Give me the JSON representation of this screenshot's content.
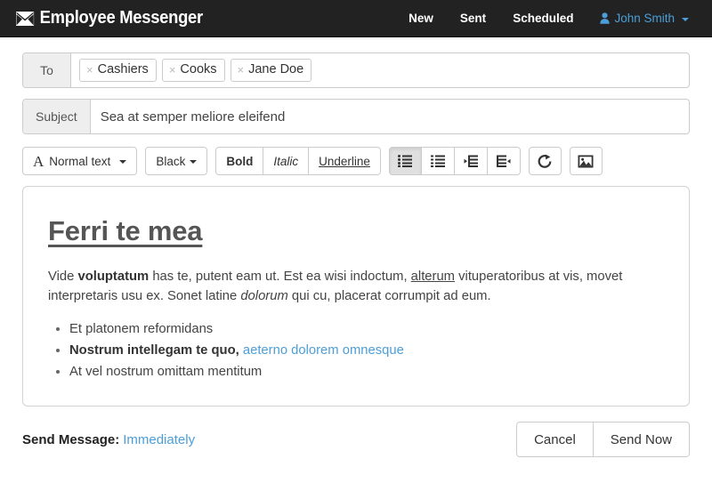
{
  "navbar": {
    "brand": "Employee Messenger",
    "brand_icon": "envelope-icon",
    "links": [
      {
        "label": "New"
      },
      {
        "label": "Sent"
      },
      {
        "label": "Scheduled"
      }
    ],
    "user": {
      "name": "John Smith",
      "icon": "user-icon",
      "caret": "chevron-down-icon"
    },
    "background_color": "#222222",
    "link_color": "#ffffff",
    "user_color": "#4c9ed9"
  },
  "compose": {
    "to": {
      "label": "To",
      "tags": [
        {
          "remove": "×",
          "label": "Cashiers"
        },
        {
          "remove": "×",
          "label": "Cooks"
        },
        {
          "remove": "×",
          "label": "Jane Doe"
        }
      ]
    },
    "subject": {
      "label": "Subject",
      "value": "Sea at semper meliore eleifend",
      "placeholder": "Subject"
    }
  },
  "toolbar": {
    "text_style": {
      "glyph": "A",
      "label": "Normal text",
      "icon": "chevron-down-icon"
    },
    "text_color": {
      "label": "Black",
      "icon": "chevron-down-icon"
    },
    "bold": "Bold",
    "italic": "Italic",
    "underline": "Underline",
    "icon_buttons": [
      {
        "name": "unordered-list-icon",
        "active": true
      },
      {
        "name": "ordered-list-icon",
        "active": false
      },
      {
        "name": "outdent-icon",
        "active": false
      },
      {
        "name": "indent-icon",
        "active": false
      },
      {
        "name": "link-icon",
        "active": false
      },
      {
        "name": "image-icon",
        "active": false
      }
    ],
    "active_color": "#e0e0e0"
  },
  "editor": {
    "heading": "Ferri te mea",
    "paragraph": {
      "part1": "Vide ",
      "bold1": "voluptatum",
      "part2": " has te, putent eam ut. Est ea wisi indoctum, ",
      "underline1": "alterum",
      "part3": " vituperatoribus at vis, movet interpretaris usu ex. Sonet latine ",
      "italic1": "dolorum",
      "part4": " qui cu, placerat corrumpit ad eum."
    },
    "list": {
      "item1": "Et platonem reformidans",
      "item2_bold": "Nostrum intellegam te quo,",
      "item2_link": "aeterno dolorem omnesque",
      "item3": "At vel nostrum omittam mentitum"
    },
    "link_color": "#4c9ed9"
  },
  "footer": {
    "send_message_label": "Send Message:",
    "send_message_value": "Immediately",
    "cancel_label": "Cancel",
    "send_now_label": "Send Now"
  }
}
